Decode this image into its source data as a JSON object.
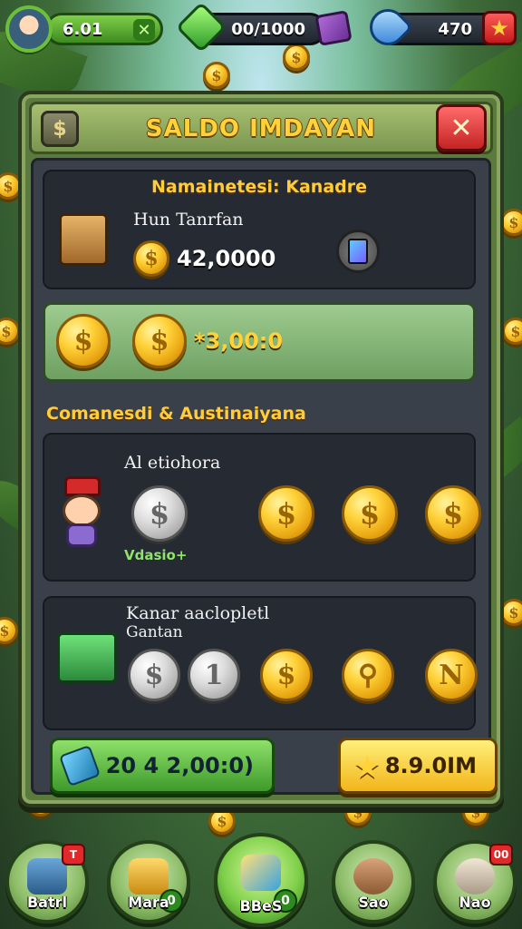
{
  "topbar": {
    "level_value": "6.01",
    "level_plus": "✕",
    "cash_value": "00/1000",
    "gems_value": "470",
    "star_icon": "★"
  },
  "panel": {
    "title": "SALDO IMDAYAN",
    "head_icon_glyph": "$",
    "close_glyph": "✕"
  },
  "section1": {
    "title": "Namainetesi: Kanadre",
    "item_label": "Hun Tanrfan",
    "amount": "42,0000",
    "coin_glyph": "$"
  },
  "greenbar": {
    "amount": "*3,00:0"
  },
  "section2": {
    "title": "Comanesdi & Austinaiyana",
    "card_label": "Al etiohora",
    "sub_label": "Vdasio+",
    "coin_glyph": "$"
  },
  "section3": {
    "label_line1": "Kanar aaclopletl",
    "label_line2": "Gantan",
    "coins": [
      "$",
      "1",
      "$",
      "⚲",
      "N"
    ]
  },
  "buttons": {
    "left_value": "20  4 2,00:0)",
    "right_value": "8.9.0IM",
    "right_icon": "★"
  },
  "nav": {
    "items": [
      {
        "label": "Batrl",
        "badge": "T"
      },
      {
        "label": "Mara",
        "count": "0"
      },
      {
        "label": "BBeS",
        "count": "0"
      },
      {
        "label": "Sao",
        "count": ""
      },
      {
        "label": "Nao",
        "badge": "00"
      }
    ]
  }
}
